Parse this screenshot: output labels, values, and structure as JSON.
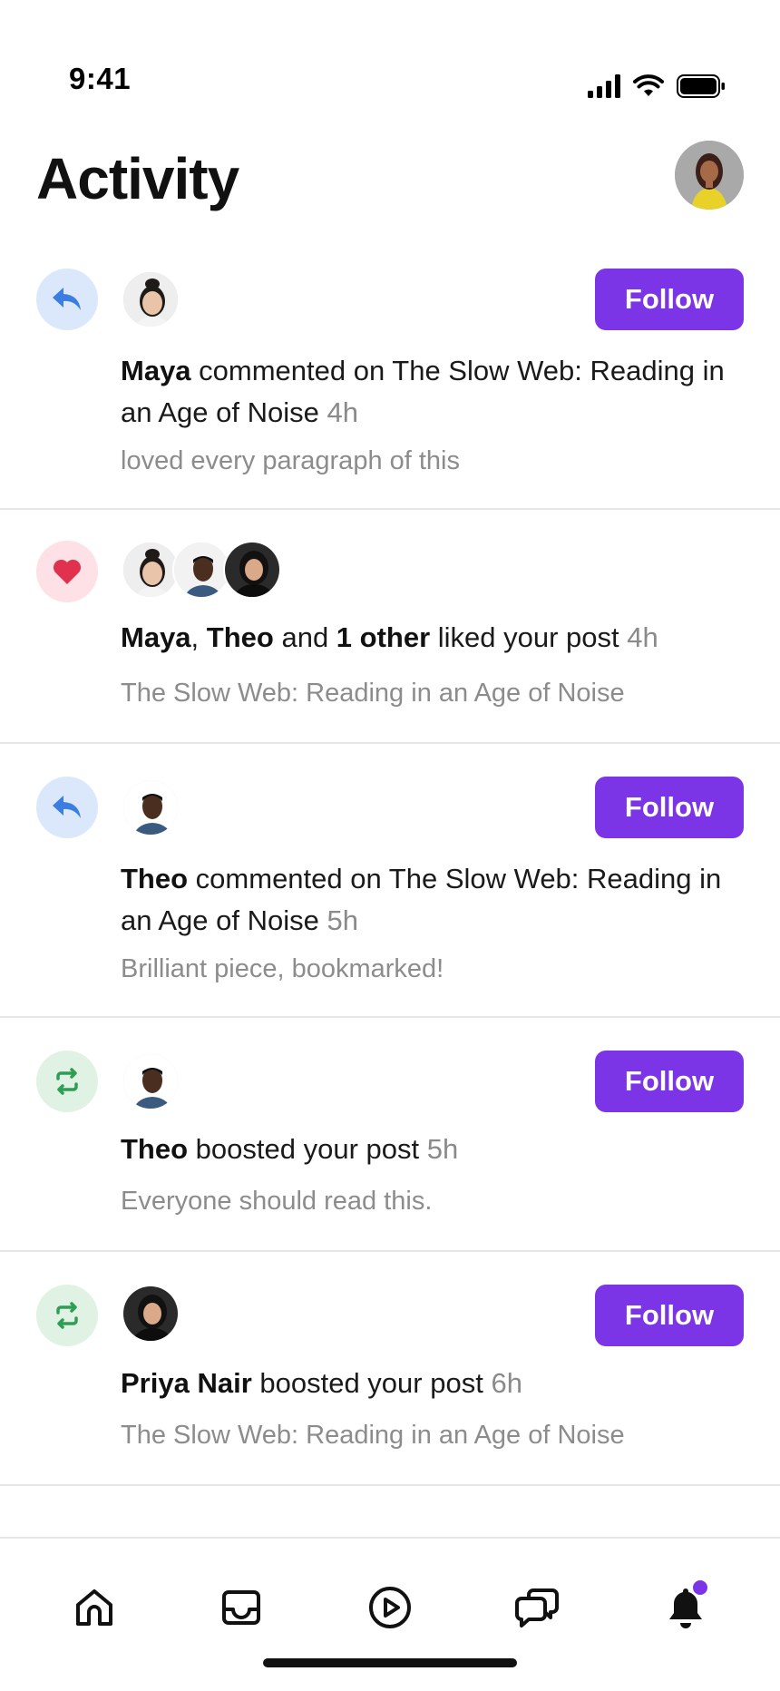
{
  "status_bar": {
    "time": "9:41"
  },
  "header": {
    "title": "Activity"
  },
  "follow_label": "Follow",
  "activities": [
    {
      "type": "comment",
      "icon": "reply-icon",
      "actor": "Maya",
      "action": " commented on The Slow Web: Reading in an Age of Noise",
      "time": "4h",
      "snippet": "loved every paragraph of this",
      "has_follow": true
    },
    {
      "type": "like",
      "icon": "heart-icon",
      "actor1": "Maya",
      "sep1": ", ",
      "actor2": "Theo",
      "sep2": " and ",
      "actor3": "1 other",
      "action": " liked your post",
      "time": "4h",
      "snippet": "The Slow Web: Reading in an Age of Noise",
      "has_follow": false
    },
    {
      "type": "comment",
      "icon": "reply-icon",
      "actor": "Theo",
      "action": " commented on The Slow Web: Reading in an Age of Noise",
      "time": "5h",
      "snippet": "Brilliant piece, bookmarked!",
      "has_follow": true
    },
    {
      "type": "boost",
      "icon": "boost-icon",
      "actor": "Theo",
      "action": " boosted your post",
      "time": "5h",
      "snippet": "Everyone should read this.",
      "has_follow": true
    },
    {
      "type": "boost",
      "icon": "boost-icon",
      "actor": "Priya Nair",
      "action": " boosted your post",
      "time": "6h",
      "snippet": "The Slow Web: Reading in an Age of Noise",
      "has_follow": true
    }
  ],
  "nav": {
    "items": [
      "home-icon",
      "inbox-icon",
      "play-icon",
      "messages-icon",
      "bell-icon"
    ],
    "active": "bell-icon",
    "notification_dot": true
  },
  "colors": {
    "accent": "#7b35e6",
    "reply_badge": "#dbe8fb",
    "reply_icon": "#3b7de0",
    "like_badge": "#fde1e6",
    "like_icon": "#e0324f",
    "boost_badge": "#dff2e4",
    "boost_icon": "#2f9e55"
  }
}
